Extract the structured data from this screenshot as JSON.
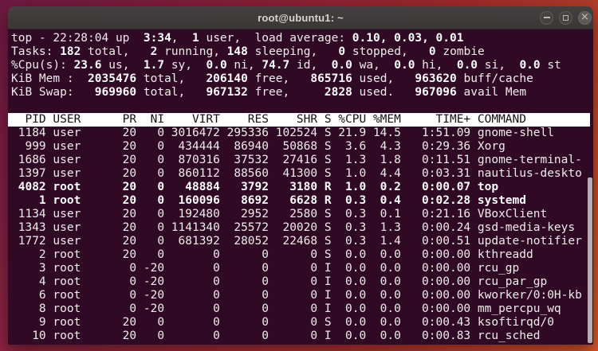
{
  "window": {
    "title": "root@ubuntu1: ~",
    "controls": {
      "close_glyph": "×"
    }
  },
  "colors": {
    "terminal_background": "#300a24",
    "header_band_background": "#ffffff",
    "titlebar_background": "#3c3b3b",
    "desktop_gradient": [
      "#7c1e4a",
      "#97253f",
      "#b5322f",
      "#d9572a"
    ],
    "scrollbar_thumb": "#b2b0ac"
  },
  "terminal": {
    "summary": [
      [
        {
          "t": "top - 22:28:04 up  ",
          "b": false
        },
        {
          "t": "3:34",
          "b": true
        },
        {
          "t": ",  ",
          "b": false
        },
        {
          "t": "1",
          "b": true
        },
        {
          "t": " user,  load average: ",
          "b": false
        },
        {
          "t": "0.10, 0.03, 0.01",
          "b": true
        }
      ],
      [
        {
          "t": "Tasks: ",
          "b": false
        },
        {
          "t": "182",
          "b": true
        },
        {
          "t": " total,   ",
          "b": false
        },
        {
          "t": "2",
          "b": true
        },
        {
          "t": " running, ",
          "b": false
        },
        {
          "t": "148",
          "b": true
        },
        {
          "t": " sleeping,   ",
          "b": false
        },
        {
          "t": "0",
          "b": true
        },
        {
          "t": " stopped,   ",
          "b": false
        },
        {
          "t": "0",
          "b": true
        },
        {
          "t": " zombie",
          "b": false
        }
      ],
      [
        {
          "t": "%Cpu(s): ",
          "b": false
        },
        {
          "t": "23.6",
          "b": true
        },
        {
          "t": " us,  ",
          "b": false
        },
        {
          "t": "1.7",
          "b": true
        },
        {
          "t": " sy,  ",
          "b": false
        },
        {
          "t": "0.0",
          "b": true
        },
        {
          "t": " ni, ",
          "b": false
        },
        {
          "t": "74.7",
          "b": true
        },
        {
          "t": " id,  ",
          "b": false
        },
        {
          "t": "0.0",
          "b": true
        },
        {
          "t": " wa,  ",
          "b": false
        },
        {
          "t": "0.0",
          "b": true
        },
        {
          "t": " hi,  ",
          "b": false
        },
        {
          "t": "0.0",
          "b": true
        },
        {
          "t": " si,  ",
          "b": false
        },
        {
          "t": "0.0",
          "b": true
        },
        {
          "t": " st",
          "b": false
        }
      ],
      [
        {
          "t": "KiB Mem :  ",
          "b": false
        },
        {
          "t": "2035476",
          "b": true
        },
        {
          "t": " total,   ",
          "b": false
        },
        {
          "t": "206140",
          "b": true
        },
        {
          "t": " free,   ",
          "b": false
        },
        {
          "t": "865716",
          "b": true
        },
        {
          "t": " used,   ",
          "b": false
        },
        {
          "t": "963620",
          "b": true
        },
        {
          "t": " buff/cache",
          "b": false
        }
      ],
      [
        {
          "t": "KiB Swap:   ",
          "b": false
        },
        {
          "t": "969960",
          "b": true
        },
        {
          "t": " total,   ",
          "b": false
        },
        {
          "t": "967132",
          "b": true
        },
        {
          "t": " free,     ",
          "b": false
        },
        {
          "t": "2828",
          "b": true
        },
        {
          "t": " used.   ",
          "b": false
        },
        {
          "t": "967096",
          "b": true
        },
        {
          "t": " avail Mem",
          "b": false
        }
      ]
    ],
    "table": {
      "header_text": "  PID USER      PR  NI    VIRT    RES    SHR S %CPU %MEM     TIME+ COMMAND",
      "columns": [
        "PID",
        "USER",
        "PR",
        "NI",
        "VIRT",
        "RES",
        "SHR",
        "S",
        "%CPU",
        "%MEM",
        "TIME+",
        "COMMAND"
      ],
      "rows": [
        {
          "pid": "1184",
          "user": "user",
          "pr": "20",
          "ni": "0",
          "virt": "3016472",
          "res": "295336",
          "shr": "102524",
          "s": "S",
          "cpu": "21.9",
          "mem": "14.5",
          "time": "1:51.09",
          "command": "gnome-shell",
          "bold": false
        },
        {
          "pid": "999",
          "user": "user",
          "pr": "20",
          "ni": "0",
          "virt": "434444",
          "res": "86940",
          "shr": "50868",
          "s": "S",
          "cpu": "3.6",
          "mem": "4.3",
          "time": "0:29.36",
          "command": "Xorg",
          "bold": false
        },
        {
          "pid": "1686",
          "user": "user",
          "pr": "20",
          "ni": "0",
          "virt": "870316",
          "res": "37532",
          "shr": "27416",
          "s": "S",
          "cpu": "1.3",
          "mem": "1.8",
          "time": "0:11.51",
          "command": "gnome-terminal-",
          "bold": false
        },
        {
          "pid": "1397",
          "user": "user",
          "pr": "20",
          "ni": "0",
          "virt": "860112",
          "res": "88560",
          "shr": "41300",
          "s": "S",
          "cpu": "1.0",
          "mem": "4.4",
          "time": "0:03.31",
          "command": "nautilus-deskto",
          "bold": false
        },
        {
          "pid": "4082",
          "user": "root",
          "pr": "20",
          "ni": "0",
          "virt": "48884",
          "res": "3792",
          "shr": "3180",
          "s": "R",
          "cpu": "1.0",
          "mem": "0.2",
          "time": "0:00.07",
          "command": "top",
          "bold": true
        },
        {
          "pid": "1",
          "user": "root",
          "pr": "20",
          "ni": "0",
          "virt": "160096",
          "res": "8692",
          "shr": "6628",
          "s": "R",
          "cpu": "0.3",
          "mem": "0.4",
          "time": "0:02.28",
          "command": "systemd",
          "bold": true
        },
        {
          "pid": "1134",
          "user": "user",
          "pr": "20",
          "ni": "0",
          "virt": "192480",
          "res": "2952",
          "shr": "2580",
          "s": "S",
          "cpu": "0.3",
          "mem": "0.1",
          "time": "0:21.16",
          "command": "VBoxClient",
          "bold": false
        },
        {
          "pid": "1343",
          "user": "user",
          "pr": "20",
          "ni": "0",
          "virt": "1141340",
          "res": "25572",
          "shr": "20020",
          "s": "S",
          "cpu": "0.3",
          "mem": "1.3",
          "time": "0:00.24",
          "command": "gsd-media-keys",
          "bold": false
        },
        {
          "pid": "1772",
          "user": "user",
          "pr": "20",
          "ni": "0",
          "virt": "681392",
          "res": "28052",
          "shr": "22468",
          "s": "S",
          "cpu": "0.3",
          "mem": "1.4",
          "time": "0:00.51",
          "command": "update-notifier",
          "bold": false
        },
        {
          "pid": "2",
          "user": "root",
          "pr": "20",
          "ni": "0",
          "virt": "0",
          "res": "0",
          "shr": "0",
          "s": "S",
          "cpu": "0.0",
          "mem": "0.0",
          "time": "0:00.00",
          "command": "kthreadd",
          "bold": false
        },
        {
          "pid": "3",
          "user": "root",
          "pr": "0",
          "ni": "-20",
          "virt": "0",
          "res": "0",
          "shr": "0",
          "s": "I",
          "cpu": "0.0",
          "mem": "0.0",
          "time": "0:00.00",
          "command": "rcu_gp",
          "bold": false
        },
        {
          "pid": "4",
          "user": "root",
          "pr": "0",
          "ni": "-20",
          "virt": "0",
          "res": "0",
          "shr": "0",
          "s": "I",
          "cpu": "0.0",
          "mem": "0.0",
          "time": "0:00.00",
          "command": "rcu_par_gp",
          "bold": false
        },
        {
          "pid": "6",
          "user": "root",
          "pr": "0",
          "ni": "-20",
          "virt": "0",
          "res": "0",
          "shr": "0",
          "s": "I",
          "cpu": "0.0",
          "mem": "0.0",
          "time": "0:00.00",
          "command": "kworker/0:0H-kb",
          "bold": false
        },
        {
          "pid": "8",
          "user": "root",
          "pr": "0",
          "ni": "-20",
          "virt": "0",
          "res": "0",
          "shr": "0",
          "s": "I",
          "cpu": "0.0",
          "mem": "0.0",
          "time": "0:00.00",
          "command": "mm_percpu_wq",
          "bold": false
        },
        {
          "pid": "9",
          "user": "root",
          "pr": "20",
          "ni": "0",
          "virt": "0",
          "res": "0",
          "shr": "0",
          "s": "S",
          "cpu": "0.0",
          "mem": "0.0",
          "time": "0:00.43",
          "command": "ksoftirqd/0",
          "bold": false
        },
        {
          "pid": "10",
          "user": "root",
          "pr": "20",
          "ni": "0",
          "virt": "0",
          "res": "0",
          "shr": "0",
          "s": "I",
          "cpu": "0.0",
          "mem": "0.0",
          "time": "0:00.83",
          "command": "rcu_sched",
          "bold": false
        }
      ]
    }
  }
}
